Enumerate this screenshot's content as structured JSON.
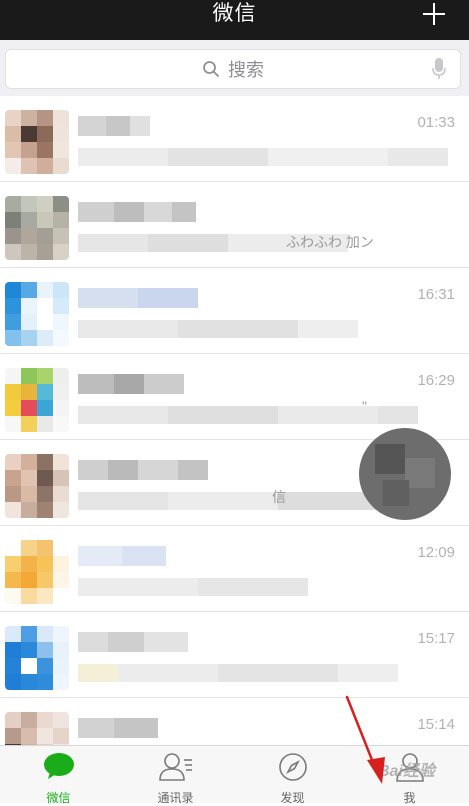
{
  "header": {
    "title": "微信",
    "add_icon": "plus-icon"
  },
  "search": {
    "placeholder": "搜索",
    "icon": "search-icon",
    "voice_icon": "microphone-icon"
  },
  "colors": {
    "header_bg": "#1a1a1a",
    "accent": "#1aad19",
    "time": "#b2b2b2"
  },
  "chats": [
    {
      "time": "01:33",
      "avatar_colors": [
        "#e9d3c6",
        "#cdb2a0",
        "#b69483",
        "#efe2d8",
        "#d9bda9",
        "#4a3a33",
        "#8c6a5a",
        "#efe4dd",
        "#e2c6b3",
        "#c5a28f",
        "#9a7563",
        "#f1e6de",
        "#f3ece8",
        "#dcc3b3",
        "#cfae9b",
        "#eadbd0"
      ],
      "name_colors": [
        "#d4d4d4",
        "#c7c7c7",
        "#e0e0e0"
      ],
      "msg_colors": [
        "#ececec",
        "#e3e3e3",
        "#f0f0f0",
        "#e8e8e8"
      ]
    },
    {
      "time": "",
      "avatar_colors": [
        "#a7aba0",
        "#c3c6bb",
        "#d0cfc4",
        "#8c8f86",
        "#7d7f79",
        "#a8a9a0",
        "#c9c7ba",
        "#b5b3a8",
        "#9a948c",
        "#b0a69b",
        "#a49f94",
        "#c8c2b6",
        "#cfc7bd",
        "#bbb4a8",
        "#a89f95",
        "#d7d1c6"
      ],
      "name_colors": [
        "#cfcfcf",
        "#bdbdbd",
        "#d8d8d8",
        "#c4c4c4"
      ],
      "msg_colors": [
        "#e6e6e6",
        "#dedede",
        "#ececec"
      ]
    },
    {
      "time": "16:31",
      "avatar_colors": [
        "#1e88d6",
        "#57a9e6",
        "#e8f3fb",
        "#cde6f7",
        "#2c93dc",
        "#e9f4fb",
        "#ffffff",
        "#d6ebf9",
        "#3f9ee0",
        "#e5f1fa",
        "#ffffff",
        "#f0f7fc",
        "#84c0ec",
        "#a8d2f2",
        "#dcedf9",
        "#f4f9fd"
      ],
      "name_colors": [
        "#d5dff0",
        "#c9d6ee"
      ],
      "msg_colors": [
        "#e9e9e9",
        "#e1e1e1",
        "#eeeeee"
      ]
    },
    {
      "time": "16:29",
      "avatar_colors": [
        "#f5f5f5",
        "#8fc65a",
        "#a9d46c",
        "#eeeeee",
        "#f1cb3e",
        "#e9b43a",
        "#57b9d8",
        "#f0f0f0",
        "#f2cd3f",
        "#e64b5b",
        "#3aa6d6",
        "#f4f4f4",
        "#f7f7f7",
        "#f3d05a",
        "#e9e9e9",
        "#f8f8f8"
      ],
      "name_colors": [
        "#bdbdbd",
        "#a8a8a8",
        "#cccccc"
      ],
      "msg_colors": [
        "#e8e8e8",
        "#dfdfdf",
        "#eaeaea",
        "#e4e4e4"
      ]
    },
    {
      "time": "",
      "avatar_colors": [
        "#e8d0c2",
        "#d2b09c",
        "#8c7264",
        "#efe3da",
        "#c9a38d",
        "#e0c3b1",
        "#6e5a50",
        "#d8c4b7",
        "#b99886",
        "#d8baa5",
        "#8e7468",
        "#eadcd3",
        "#f0e4dc",
        "#c9ad9c",
        "#a08272",
        "#efe6e0"
      ],
      "name_colors": [
        "#cfcfcf",
        "#bababa",
        "#d6d6d6",
        "#c3c3c3"
      ],
      "msg_colors": [
        "#e5e5e5",
        "#ececec",
        "#dddddd"
      ]
    },
    {
      "time": "12:09",
      "avatar_colors": [
        "#ffffff",
        "#f6d28b",
        "#f3c46d",
        "#ffffff",
        "#f7cf6e",
        "#f4b24a",
        "#f6c25a",
        "#fdf3df",
        "#f5b84d",
        "#f2a938",
        "#f7c867",
        "#fdf5e6",
        "#fefaf2",
        "#f9dba0",
        "#fbe7c2",
        "#ffffff"
      ],
      "name_colors": [
        "#e4ebf6",
        "#d9e3f3"
      ],
      "msg_colors": [
        "#ececec",
        "#e6e6e6"
      ]
    },
    {
      "time": "15:17",
      "avatar_colors": [
        "#dbeafa",
        "#4f9de4",
        "#d9e9fa",
        "#eef5fc",
        "#1f7fd6",
        "#2c89da",
        "#8ec0ee",
        "#e9f2fb",
        "#2483d8",
        "#ffffff",
        "#3b93de",
        "#eaf3fb",
        "#1f7fd6",
        "#2a88d9",
        "#2f8bdb",
        "#eef5fc"
      ],
      "name_colors": [
        "#dcdcdc",
        "#cfcfcf",
        "#e3e3e3"
      ],
      "msg_colors": [
        "#f4efd6",
        "#ececec",
        "#e4e4e4",
        "#eeeeee"
      ]
    },
    {
      "time": "15:14",
      "avatar_colors": [
        "#e4cfc6",
        "#c9ad9f",
        "#ead9d0",
        "#efe4de",
        "#b69a8c",
        "#d8bcae",
        "#f0e5df",
        "#e6d3c9",
        "#3f3a37",
        "#cfb4a6",
        "#e3cfc5",
        "#f1e8e3",
        "#f4ece8",
        "#e2ccc1",
        "#eadcd4",
        "#f5eeea"
      ],
      "name_colors": [
        "#d2d2d2",
        "#c5c5c5"
      ],
      "msg_colors": [
        "#e7e7e7",
        "#e0e0e0"
      ]
    }
  ],
  "overlay_snippets": {
    "chat2": "ふわふわ 加ン",
    "chat4": "\"",
    "chat5": "信"
  },
  "tabs": [
    {
      "label": "微信",
      "icon": "chat-bubble-icon",
      "active": true
    },
    {
      "label": "通讯录",
      "icon": "contacts-icon",
      "active": false
    },
    {
      "label": "发现",
      "icon": "compass-icon",
      "active": false
    },
    {
      "label": "我",
      "icon": "profile-icon",
      "active": false
    }
  ],
  "watermark": "Bai经验"
}
